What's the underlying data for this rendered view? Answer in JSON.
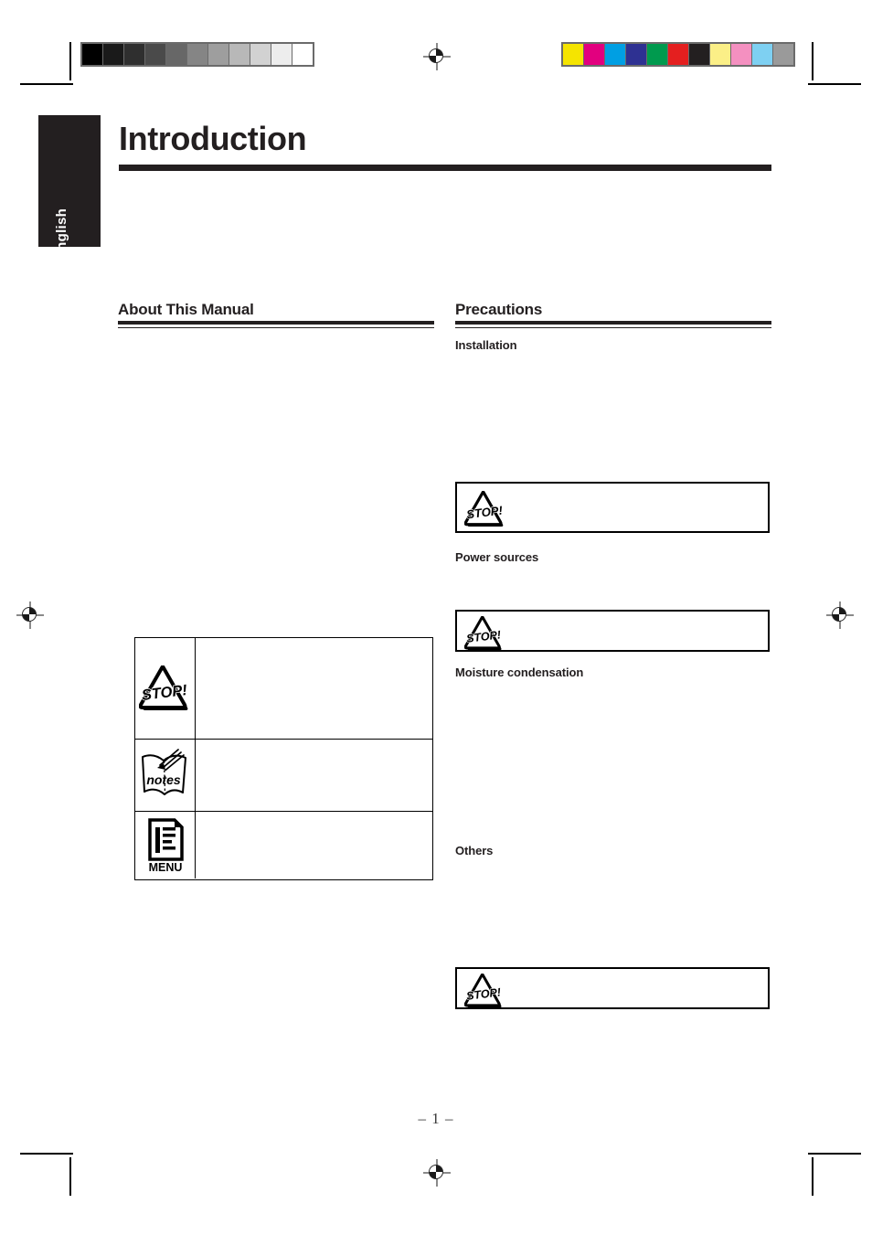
{
  "document": {
    "page_title": "Introduction",
    "language_tab": "English",
    "page_number": "– 1 –"
  },
  "left_column": {
    "heading": "About This Manual",
    "legend_table": {
      "rows": [
        {
          "icon": "stop-sign-icon",
          "icon_label": "STOP!",
          "description": ""
        },
        {
          "icon": "notes-book-icon",
          "icon_label": "notes",
          "description": ""
        },
        {
          "icon": "menu-document-icon",
          "icon_label": "MENU",
          "description": ""
        }
      ]
    }
  },
  "right_column": {
    "heading": "Precautions",
    "subheadings": [
      "Installation",
      "Power sources",
      "Moisture condensation",
      "Others"
    ],
    "caution_boxes": [
      {
        "icon": "stop-sign-icon",
        "icon_label": "STOP!",
        "text": ""
      },
      {
        "icon": "stop-sign-icon",
        "icon_label": "STOP!",
        "text": ""
      },
      {
        "icon": "stop-sign-icon",
        "icon_label": "STOP!",
        "text": ""
      }
    ]
  },
  "print_marks": {
    "grayscale_strip": {
      "label": "grayscale-calibration-strip",
      "swatches": [
        "#000000",
        "#1a1a1a",
        "#2f2f2f",
        "#4a4a4a",
        "#676767",
        "#858585",
        "#9e9e9e",
        "#b8b8b8",
        "#d2d2d2",
        "#ededed",
        "#ffffff"
      ]
    },
    "color_strip": {
      "label": "color-calibration-strip",
      "swatches": [
        "#f5e400",
        "#e2007f",
        "#009fe3",
        "#2e3192",
        "#009a4e",
        "#e41f1f",
        "#231f20",
        "#fbef87",
        "#f490c0",
        "#7ed0f2",
        "#9a9a9a"
      ]
    },
    "registration_marks": 4,
    "crop_marks": 8
  }
}
